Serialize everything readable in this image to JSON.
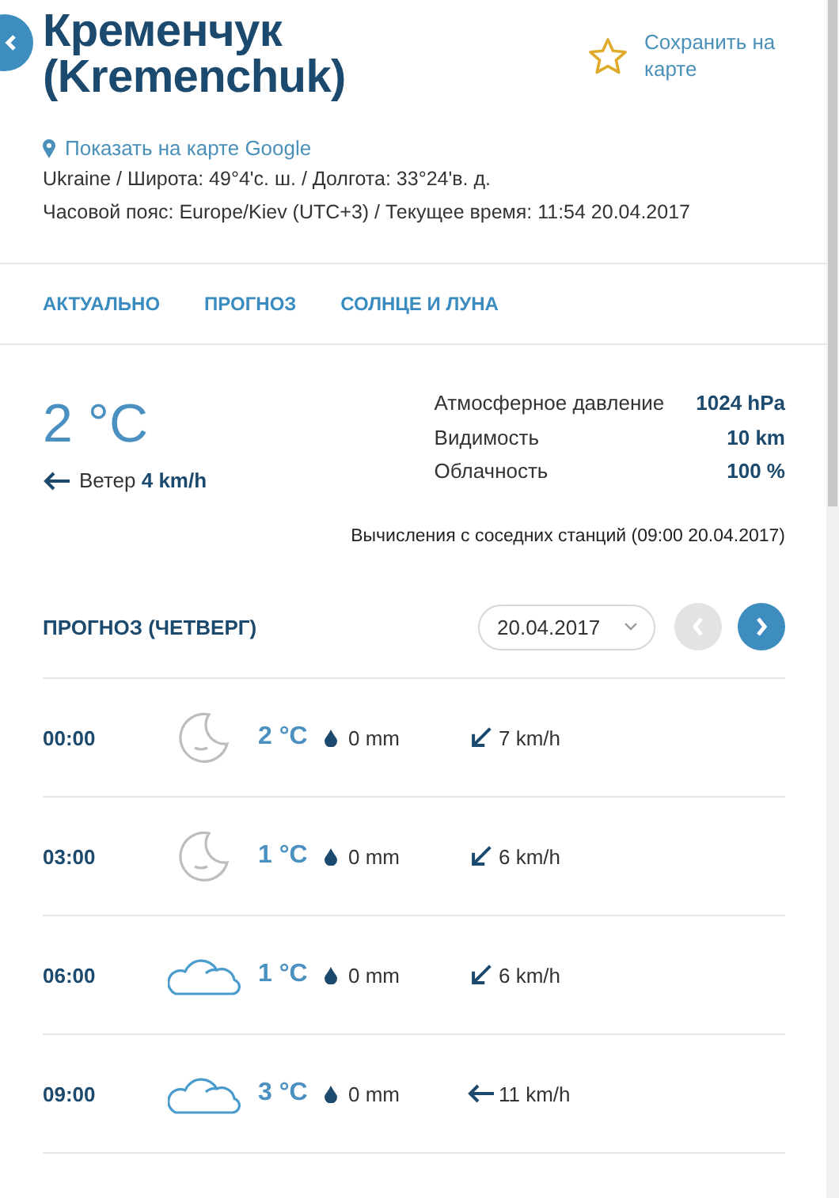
{
  "header": {
    "title": "Кременчук (Kremenchuk)",
    "save_label": "Сохранить на карте",
    "map_link": "Показать на карте Google",
    "location_line": "Ukraine / Широта: 49°4'с. ш. / Долгота: 33°24'в. д.",
    "timezone_line": "Часовой пояс: Europe/Kiev (UTC+3) / Текущее время: 11:54 20.04.2017"
  },
  "tabs": [
    {
      "label": "АКТУАЛЬНО"
    },
    {
      "label": "ПРОГНОЗ"
    },
    {
      "label": "СОЛНЦЕ И ЛУНА"
    }
  ],
  "current": {
    "temperature": "2 °C",
    "wind": {
      "kind": "w",
      "text": "Ветер **4 km/h**"
    },
    "stats": [
      {
        "label": "Атмосферное давление",
        "value": "1024 hPa"
      },
      {
        "label": "Видимость",
        "value": "10 km"
      },
      {
        "label": "Облачность",
        "value": "100 %"
      }
    ],
    "note": "Вычисления с соседних станций (09:00 20.04.2017)"
  },
  "forecast": {
    "title": "ПРОГНОЗ (ЧЕТВЕРГ)",
    "date": "20.04.2017",
    "prev_disabled": true,
    "next_disabled": false,
    "rows": [
      {
        "time": "00:00",
        "kind": "moon",
        "temperature": "2 °C",
        "precipitation": "0 mm",
        "wind": {
          "kind": "sw",
          "speed": "7 km/h"
        }
      },
      {
        "time": "03:00",
        "kind": "moon",
        "temperature": "1 °C",
        "precipitation": "0 mm",
        "wind": {
          "kind": "sw",
          "speed": "6 km/h"
        }
      },
      {
        "time": "06:00",
        "kind": "cloud",
        "temperature": "1 °C",
        "precipitation": "0 mm",
        "wind": {
          "kind": "sw",
          "speed": "6 km/h"
        }
      },
      {
        "time": "09:00",
        "kind": "cloud",
        "temperature": "3 °C",
        "precipitation": "0 mm",
        "wind": {
          "kind": "w",
          "speed": "11 km/h"
        }
      }
    ]
  }
}
